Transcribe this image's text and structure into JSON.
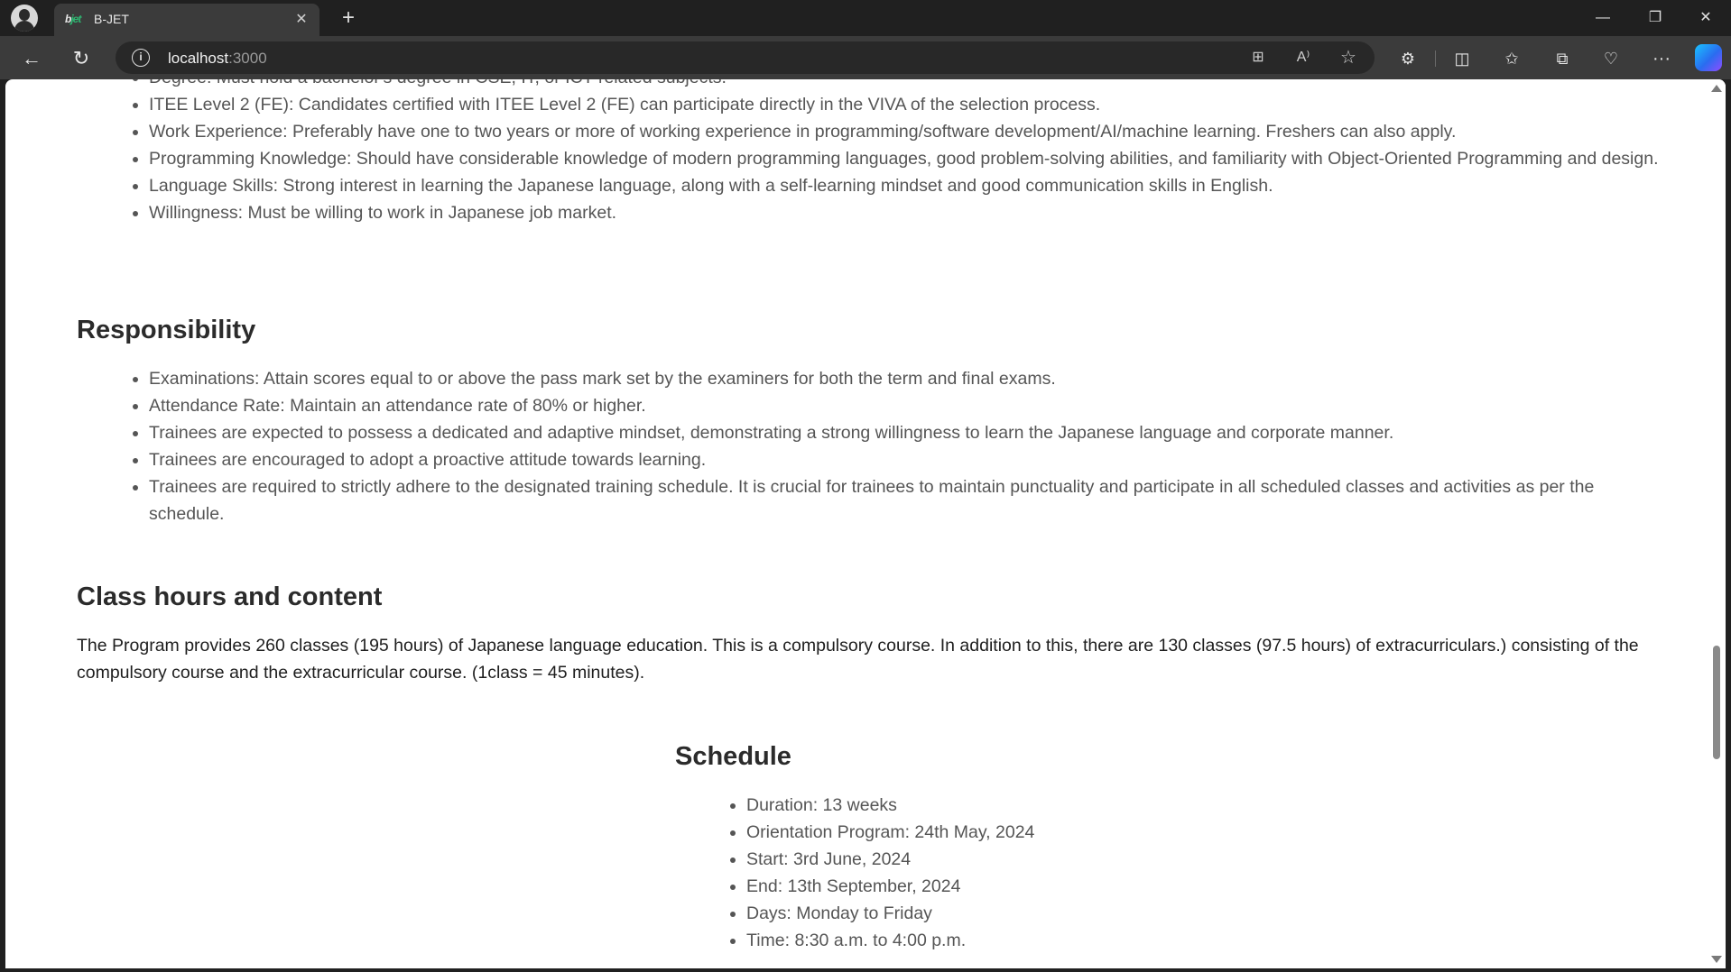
{
  "browser": {
    "tab_title": "B-JET",
    "tab_favicon": "bjet",
    "url_host": "localhost",
    "url_port": ":3000",
    "icons": {
      "back": "back-arrow-icon",
      "reload": "reload-icon",
      "info": "info-icon",
      "close_tab": "close-icon",
      "new_tab": "plus-icon",
      "favorite": "star-icon",
      "more": "ellipsis-icon"
    }
  },
  "glyphs": {
    "tab_close": "✕",
    "new_tab": "+",
    "minimize": "—",
    "maximize": "❐",
    "close": "✕",
    "back": "←",
    "reload": "↻",
    "info": "i",
    "apps": "⊞",
    "read_aloud": "A⁾",
    "star": "☆",
    "extensions": "⚙",
    "split": "◫",
    "favorites": "✩",
    "collections": "⧉",
    "health": "♡",
    "more": "···"
  },
  "eligibility": {
    "items": [
      "Degree: Must hold a bachelor's degree in CSE, IT, or ICT-related subjects.",
      "ITEE Level 2 (FE): Candidates certified with ITEE Level 2 (FE) can participate directly in the VIVA of the selection process.",
      "Work Experience: Preferably have one to two years or more of working experience in programming/software development/AI/machine learning. Freshers can also apply.",
      "Programming Knowledge: Should have considerable knowledge of modern programming languages, good problem-solving abilities, and familiarity with Object-Oriented Programming and design.",
      "Language Skills: Strong interest in learning the Japanese language, along with a self-learning mindset and good communication skills in English.",
      "Willingness: Must be willing to work in Japanese job market."
    ]
  },
  "responsibility": {
    "heading": "Responsibility",
    "items": [
      "Examinations: Attain scores equal to or above the pass mark set by the examiners for both the term and final exams.",
      "Attendance Rate: Maintain an attendance rate of 80% or higher.",
      "Trainees are expected to possess a dedicated and adaptive mindset, demonstrating a strong willingness to learn the Japanese language and corporate manner.",
      "Trainees are encouraged to adopt a proactive attitude towards learning.",
      "Trainees are required to strictly adhere to the designated training schedule. It is crucial for trainees to maintain punctuality and participate in all scheduled classes and activities as per the schedule."
    ]
  },
  "class_hours": {
    "heading": "Class hours and content",
    "paragraph": "The Program provides 260 classes (195 hours) of Japanese language education. This is a compulsory course. In addition to this, there are 130 classes (97.5 hours) of extracurriculars.) consisting of the compulsory course and the extracurricular course. (1class = 45 minutes)."
  },
  "schedule": {
    "heading": "Schedule",
    "items": [
      "Duration: 13 weeks",
      "Orientation Program: 24th May, 2024",
      "Start: 3rd June, 2024",
      "End: 13th September, 2024",
      "Days: Monday to Friday",
      "Time: 8:30 a.m. to 4:00 p.m."
    ]
  }
}
